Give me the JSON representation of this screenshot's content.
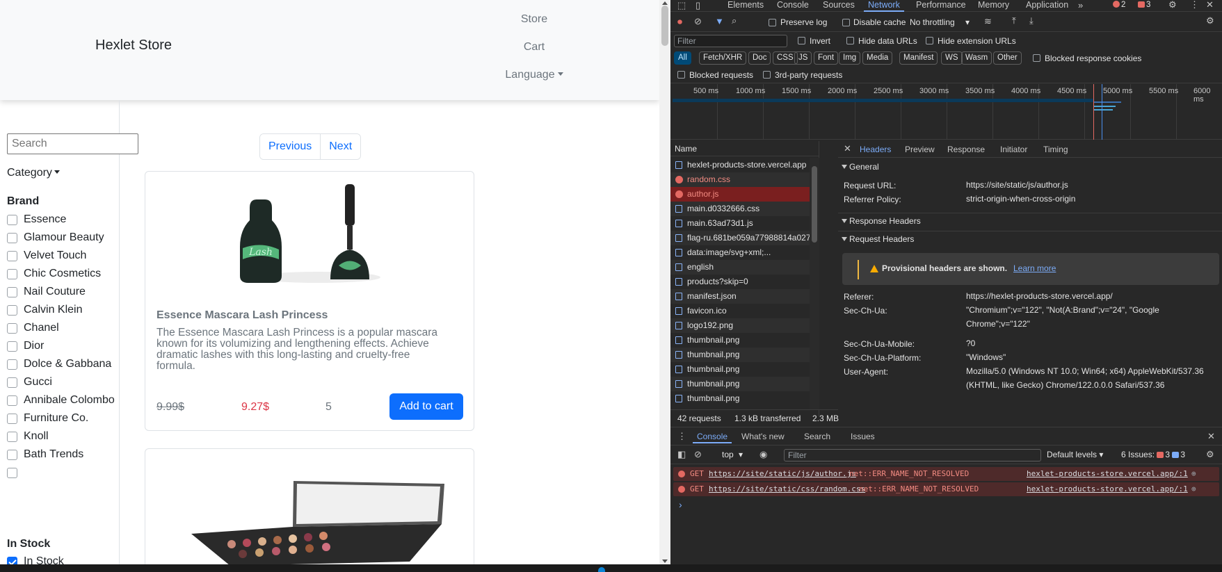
{
  "site": {
    "brand": "Hexlet Store",
    "nav": {
      "store": "Store",
      "cart": "Cart",
      "language": "Language"
    },
    "search_placeholder": "Search",
    "category_label": "Category",
    "brand_heading": "Brand",
    "brands": [
      {
        "label": "Essence"
      },
      {
        "label": "Glamour Beauty"
      },
      {
        "label": "Velvet Touch"
      },
      {
        "label": "Chic Cosmetics"
      },
      {
        "label": "Nail Couture"
      },
      {
        "label": "Calvin Klein"
      },
      {
        "label": "Chanel"
      },
      {
        "label": "Dior"
      },
      {
        "label": "Dolce & Gabbana"
      },
      {
        "label": "Gucci"
      },
      {
        "label": "Annibale Colombo"
      },
      {
        "label": "Furniture Co."
      },
      {
        "label": "Knoll"
      },
      {
        "label": "Bath Trends"
      },
      {
        "label": ""
      }
    ],
    "stock_heading": "In Stock",
    "stock_option": "In Stock",
    "pagination": {
      "previous": "Previous",
      "next": "Next"
    },
    "products": [
      {
        "title": "Essence Mascara Lash Princess",
        "description": "The Essence Mascara Lash Princess is a popular mascara known for its volumizing and lengthening effects. Achieve dramatic lashes with this long-lasting and cruelty-free formula.",
        "old_price": "9.99$",
        "new_price": "9.27$",
        "rating": "5",
        "add_label": "Add to cart",
        "image_text": "Lash Princess"
      }
    ]
  },
  "devtools": {
    "tabs": [
      "Elements",
      "Console",
      "Sources",
      "Network",
      "Performance",
      "Memory",
      "Application"
    ],
    "active_tab": "Network",
    "error_count": "2",
    "issue_count": "3",
    "toolbar": {
      "preserve_log": "Preserve log",
      "disable_cache": "Disable cache",
      "throttling": "No throttling"
    },
    "filter": {
      "placeholder": "Filter",
      "invert": "Invert",
      "hide_data_urls": "Hide data URLs",
      "hide_extension_urls": "Hide extension URLs"
    },
    "types": [
      "All",
      "Fetch/XHR",
      "Doc",
      "CSS",
      "JS",
      "Font",
      "Img",
      "Media",
      "Manifest",
      "WS",
      "Wasm",
      "Other"
    ],
    "blocked_cookies": "Blocked response cookies",
    "blocked_requests": "Blocked requests",
    "third_party": "3rd-party requests",
    "timeline_labels": [
      "500 ms",
      "1000 ms",
      "1500 ms",
      "2000 ms",
      "2500 ms",
      "3000 ms",
      "3500 ms",
      "4000 ms",
      "4500 ms",
      "5000 ms",
      "5500 ms",
      "6000 ms"
    ],
    "name_header": "Name",
    "requests": [
      {
        "name": "hexlet-products-store.vercel.app",
        "state": "normal"
      },
      {
        "name": "random.css",
        "state": "err"
      },
      {
        "name": "author.js",
        "state": "selected"
      },
      {
        "name": "main.d0332666.css",
        "state": "normal"
      },
      {
        "name": "main.63ad73d1.js",
        "state": "normal"
      },
      {
        "name": "flag-ru.681be059a77988814a02724...",
        "state": "normal"
      },
      {
        "name": "data:image/svg+xml;...",
        "state": "normal"
      },
      {
        "name": "english",
        "state": "normal"
      },
      {
        "name": "products?skip=0",
        "state": "normal"
      },
      {
        "name": "manifest.json",
        "state": "normal"
      },
      {
        "name": "favicon.ico",
        "state": "normal"
      },
      {
        "name": "logo192.png",
        "state": "normal"
      },
      {
        "name": "thumbnail.png",
        "state": "normal"
      },
      {
        "name": "thumbnail.png",
        "state": "normal"
      },
      {
        "name": "thumbnail.png",
        "state": "normal"
      },
      {
        "name": "thumbnail.png",
        "state": "normal"
      },
      {
        "name": "thumbnail.png",
        "state": "normal"
      }
    ],
    "footer": {
      "requests": "42 requests",
      "transferred": "1.3 kB transferred",
      "resources": "2.3 MB"
    },
    "detail_tabs": [
      "Headers",
      "Preview",
      "Response",
      "Initiator",
      "Timing"
    ],
    "general_label": "General",
    "general": [
      {
        "k": "Request URL:",
        "v": "https://site/static/js/author.js"
      },
      {
        "k": "Referrer Policy:",
        "v": "strict-origin-when-cross-origin"
      }
    ],
    "response_headers_label": "Response Headers",
    "request_headers_label": "Request Headers",
    "provisional": "Provisional headers are shown.",
    "learn_more": "Learn more",
    "request_headers": [
      {
        "k": "Referer:",
        "v": "https://hexlet-products-store.vercel.app/"
      },
      {
        "k": "Sec-Ch-Ua:",
        "v": "\"Chromium\";v=\"122\", \"Not(A:Brand\";v=\"24\", \"Google Chrome\";v=\"122\""
      },
      {
        "k": "Sec-Ch-Ua-Mobile:",
        "v": "?0"
      },
      {
        "k": "Sec-Ch-Ua-Platform:",
        "v": "\"Windows\""
      },
      {
        "k": "User-Agent:",
        "v": "Mozilla/5.0 (Windows NT 10.0; Win64; x64) AppleWebKit/537.36 (KHTML, like Gecko) Chrome/122.0.0.0 Safari/537.36"
      }
    ],
    "drawer_tabs": [
      "Console",
      "What's new",
      "Search",
      "Issues"
    ],
    "console_context": "top",
    "console_filter": "Filter",
    "default_levels": "Default levels",
    "issues_label": "6 Issues:",
    "issues_err": "3",
    "issues_info": "3",
    "console_messages": [
      {
        "method": "GET",
        "url": "https://site/static/js/author.js",
        "error": "net::ERR_NAME_NOT_RESOLVED",
        "source": "hexlet-products-store.vercel.app/:1"
      },
      {
        "method": "GET",
        "url": "https://site/static/css/random.css",
        "error": "net::ERR_NAME_NOT_RESOLVED",
        "source": "hexlet-products-store.vercel.app/:1"
      }
    ],
    "prompt": "›"
  }
}
